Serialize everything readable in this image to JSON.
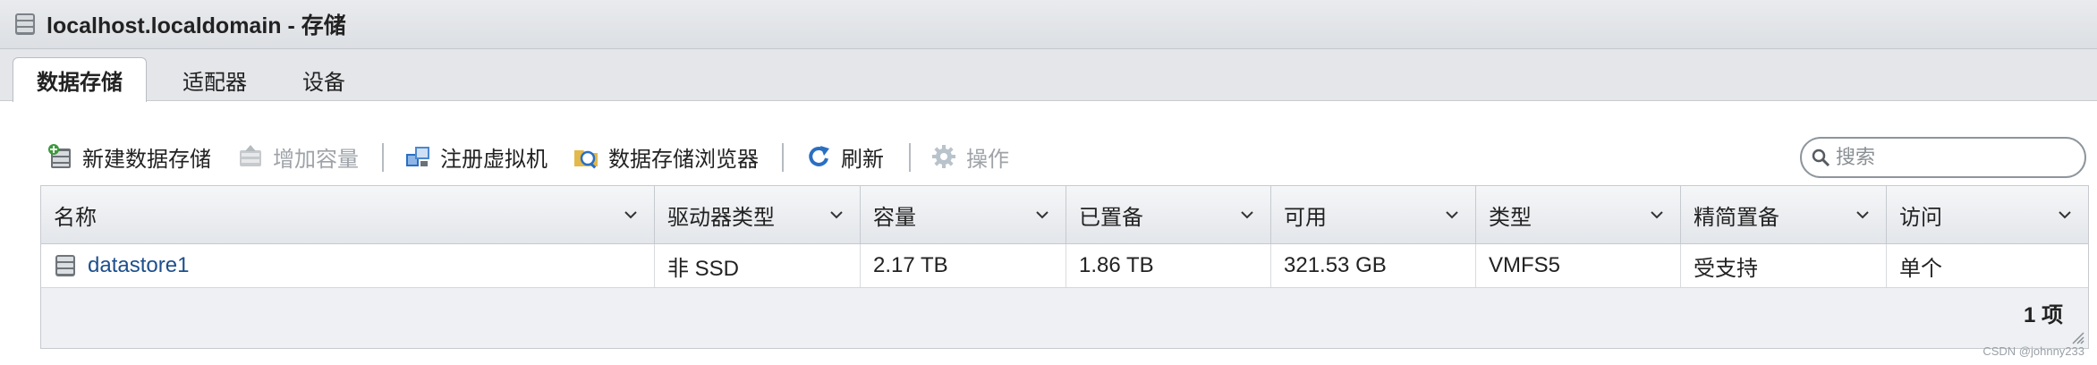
{
  "window": {
    "title": "localhost.localdomain - 存储"
  },
  "tabs": [
    {
      "label": "数据存储",
      "active": true
    },
    {
      "label": "适配器",
      "active": false
    },
    {
      "label": "设备",
      "active": false
    }
  ],
  "toolbar": {
    "new_datastore": "新建数据存储",
    "increase_capacity": "增加容量",
    "register_vm": "注册虚拟机",
    "datastore_browser": "数据存储浏览器",
    "refresh": "刷新",
    "actions": "操作"
  },
  "search": {
    "placeholder": "搜索",
    "value": ""
  },
  "table": {
    "columns": [
      "名称",
      "驱动器类型",
      "容量",
      "已置备",
      "可用",
      "类型",
      "精简置备",
      "访问"
    ],
    "rows": [
      {
        "name": "datastore1",
        "drive_type": "非 SSD",
        "capacity": "2.17 TB",
        "provisioned": "1.86 TB",
        "free": "321.53 GB",
        "type": "VMFS5",
        "thin_provisioning": "受支持",
        "access": "单个"
      }
    ],
    "item_count": "1 项"
  },
  "watermark": "CSDN @johnny233",
  "colors": {
    "link": "#1d4f8c",
    "disabled": "#9ea3a8",
    "accent_blue": "#2a6fc2"
  }
}
